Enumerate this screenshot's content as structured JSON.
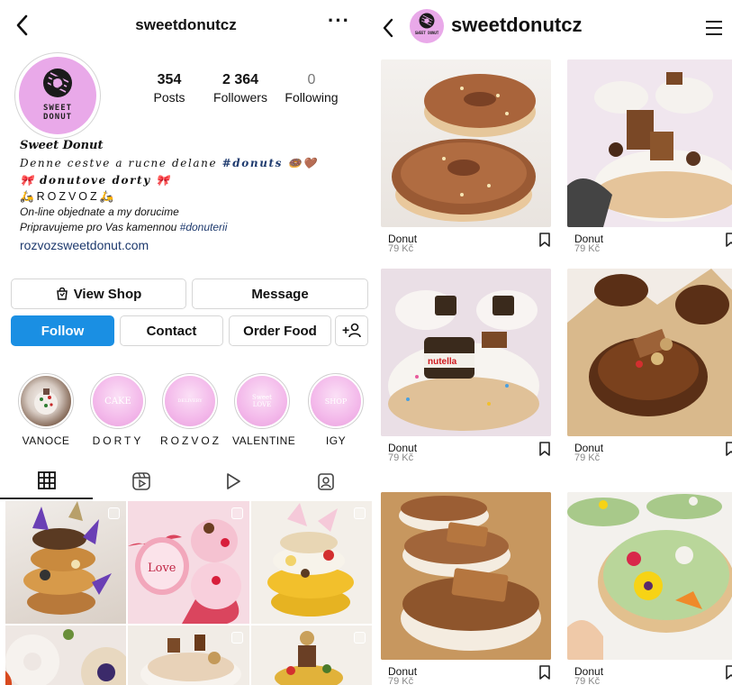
{
  "left": {
    "header": {
      "username": "sweetdonutcz",
      "more_glyph": "···"
    },
    "avatar": {
      "brand_line1": "SWEET",
      "brand_line2": "DONUT"
    },
    "stats": [
      {
        "value": "354",
        "label": "Posts"
      },
      {
        "value": "2 364",
        "label": "Followers"
      },
      {
        "value": "0",
        "label": "Following"
      }
    ],
    "bio": {
      "name": "Sweet Donut",
      "line1": "Denne cestve a rucne delane",
      "line1_tag": "#donuts",
      "line1_emoji": "🍩🤎",
      "line2_emoji_left": "🎀",
      "line2": "donutove dorty",
      "line2_emoji_right": "🎀",
      "line3": "🛵ROZVOZ🛵",
      "line4": "On-line objednate a my dorucime",
      "line5": "Pripravujeme pro Vas kamennou",
      "line5_tag": "#donuterii",
      "link": "rozvozsweetdonut.com"
    },
    "buttons": {
      "view_shop": "View Shop",
      "message": "Message",
      "follow": "Follow",
      "contact": "Contact",
      "order_food": "Order Food",
      "add_person_glyph": "+"
    },
    "highlights": [
      {
        "label": "VANOCE",
        "inner_text": ""
      },
      {
        "label": "DORTY",
        "inner_text": "CAKE"
      },
      {
        "label": "ROZVOZ",
        "inner_text": "DELIVERY"
      },
      {
        "label": "VALENTINE",
        "inner_text": "Sweet LOVE"
      },
      {
        "label": "IGY",
        "inner_text": "SHOP"
      }
    ]
  },
  "right": {
    "header": {
      "username": "sweetdonutcz",
      "avatar_brand": "SWEET DONUT"
    },
    "products": [
      {
        "name": "Donut",
        "price": "79 Kč"
      },
      {
        "name": "Donut",
        "price": "79 Kč"
      },
      {
        "name": "Donut",
        "price": "79 Kč"
      },
      {
        "name": "Donut",
        "price": "79 Kč"
      },
      {
        "name": "Donut",
        "price": "79 Kč"
      },
      {
        "name": "Donut",
        "price": "79 Kč"
      }
    ]
  },
  "colors": {
    "follow_blue": "#1a8fe3",
    "brand_pink": "#e9a9e9",
    "link_blue": "#1e3a6e"
  },
  "icons": {
    "grid_tab": "grid-icon",
    "reels_tab": "reels-icon",
    "video_tab": "play-icon",
    "tagged_tab": "tagged-person-icon",
    "bookmark": "bookmark-icon",
    "menu": "hamburger-menu-icon"
  }
}
